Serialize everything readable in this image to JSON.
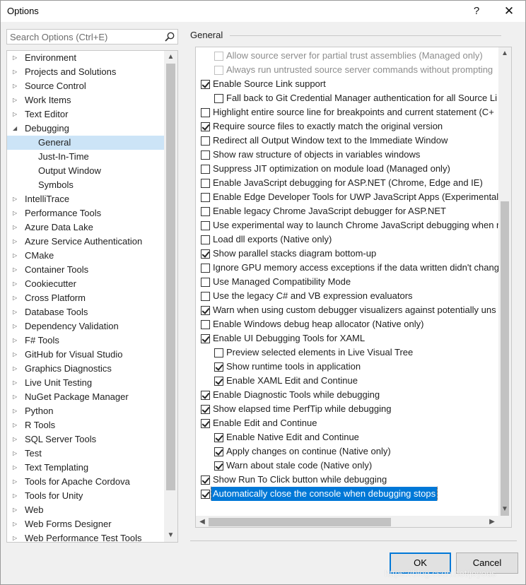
{
  "window": {
    "title": "Options",
    "help_label": "?",
    "close_label": "✕"
  },
  "search": {
    "placeholder": "Search Options (Ctrl+E)"
  },
  "tree": {
    "items": [
      {
        "label": "Environment",
        "expander": "▷",
        "level": 0
      },
      {
        "label": "Projects and Solutions",
        "expander": "▷",
        "level": 0
      },
      {
        "label": "Source Control",
        "expander": "▷",
        "level": 0
      },
      {
        "label": "Work Items",
        "expander": "▷",
        "level": 0
      },
      {
        "label": "Text Editor",
        "expander": "▷",
        "level": 0
      },
      {
        "label": "Debugging",
        "expander": "◢",
        "level": 0
      },
      {
        "label": "General",
        "expander": "",
        "level": 1,
        "selected": true
      },
      {
        "label": "Just-In-Time",
        "expander": "",
        "level": 1
      },
      {
        "label": "Output Window",
        "expander": "",
        "level": 1
      },
      {
        "label": "Symbols",
        "expander": "",
        "level": 1
      },
      {
        "label": "IntelliTrace",
        "expander": "▷",
        "level": 0
      },
      {
        "label": "Performance Tools",
        "expander": "▷",
        "level": 0
      },
      {
        "label": "Azure Data Lake",
        "expander": "▷",
        "level": 0
      },
      {
        "label": "Azure Service Authentication",
        "expander": "▷",
        "level": 0
      },
      {
        "label": "CMake",
        "expander": "▷",
        "level": 0
      },
      {
        "label": "Container Tools",
        "expander": "▷",
        "level": 0
      },
      {
        "label": "Cookiecutter",
        "expander": "▷",
        "level": 0
      },
      {
        "label": "Cross Platform",
        "expander": "▷",
        "level": 0
      },
      {
        "label": "Database Tools",
        "expander": "▷",
        "level": 0
      },
      {
        "label": "Dependency Validation",
        "expander": "▷",
        "level": 0
      },
      {
        "label": "F# Tools",
        "expander": "▷",
        "level": 0
      },
      {
        "label": "GitHub for Visual Studio",
        "expander": "▷",
        "level": 0
      },
      {
        "label": "Graphics Diagnostics",
        "expander": "▷",
        "level": 0
      },
      {
        "label": "Live Unit Testing",
        "expander": "▷",
        "level": 0
      },
      {
        "label": "NuGet Package Manager",
        "expander": "▷",
        "level": 0
      },
      {
        "label": "Python",
        "expander": "▷",
        "level": 0
      },
      {
        "label": "R Tools",
        "expander": "▷",
        "level": 0
      },
      {
        "label": "SQL Server Tools",
        "expander": "▷",
        "level": 0
      },
      {
        "label": "Test",
        "expander": "▷",
        "level": 0
      },
      {
        "label": "Text Templating",
        "expander": "▷",
        "level": 0
      },
      {
        "label": "Tools for Apache Cordova",
        "expander": "▷",
        "level": 0
      },
      {
        "label": "Tools for Unity",
        "expander": "▷",
        "level": 0
      },
      {
        "label": "Web",
        "expander": "▷",
        "level": 0
      },
      {
        "label": "Web Forms Designer",
        "expander": "▷",
        "level": 0
      },
      {
        "label": "Web Performance Test Tools",
        "expander": "▷",
        "level": 0
      }
    ],
    "scroll_up": "▲",
    "scroll_down": "▼"
  },
  "section": {
    "title": "General"
  },
  "options": [
    {
      "label": "Allow source server for partial trust assemblies (Managed only)",
      "checked": false,
      "level": 1,
      "disabled": true
    },
    {
      "label": "Always run untrusted source server commands without prompting",
      "checked": false,
      "level": 1,
      "disabled": true
    },
    {
      "label": "Enable Source Link support",
      "checked": true,
      "level": 0
    },
    {
      "label": "Fall back to Git Credential Manager authentication for all Source Li",
      "checked": false,
      "level": 1
    },
    {
      "label": "Highlight entire source line for breakpoints and current statement (C+",
      "checked": false,
      "level": 0
    },
    {
      "label": "Require source files to exactly match the original version",
      "checked": true,
      "level": 0
    },
    {
      "label": "Redirect all Output Window text to the Immediate Window",
      "checked": false,
      "level": 0
    },
    {
      "label": "Show raw structure of objects in variables windows",
      "checked": false,
      "level": 0
    },
    {
      "label": "Suppress JIT optimization on module load (Managed only)",
      "checked": false,
      "level": 0
    },
    {
      "label": "Enable JavaScript debugging for ASP.NET (Chrome, Edge and IE)",
      "checked": false,
      "level": 0
    },
    {
      "label": "Enable Edge Developer Tools for UWP JavaScript Apps (Experimental",
      "checked": false,
      "level": 0
    },
    {
      "label": "Enable legacy Chrome JavaScript debugger for ASP.NET",
      "checked": false,
      "level": 0
    },
    {
      "label": "Use experimental way to launch Chrome JavaScript debugging when r",
      "checked": false,
      "level": 0
    },
    {
      "label": "Load dll exports (Native only)",
      "checked": false,
      "level": 0
    },
    {
      "label": "Show parallel stacks diagram bottom-up",
      "checked": true,
      "level": 0
    },
    {
      "label": "Ignore GPU memory access exceptions if the data written didn't chang",
      "checked": false,
      "level": 0
    },
    {
      "label": "Use Managed Compatibility Mode",
      "checked": false,
      "level": 0
    },
    {
      "label": "Use the legacy C# and VB expression evaluators",
      "checked": false,
      "level": 0
    },
    {
      "label": "Warn when using custom debugger visualizers against potentially uns",
      "checked": true,
      "level": 0
    },
    {
      "label": "Enable Windows debug heap allocator (Native only)",
      "checked": false,
      "level": 0
    },
    {
      "label": "Enable UI Debugging Tools for XAML",
      "checked": true,
      "level": 0
    },
    {
      "label": "Preview selected elements in Live Visual Tree",
      "checked": false,
      "level": 1
    },
    {
      "label": "Show runtime tools in application",
      "checked": true,
      "level": 1
    },
    {
      "label": "Enable XAML Edit and Continue",
      "checked": true,
      "level": 1
    },
    {
      "label": "Enable Diagnostic Tools while debugging",
      "checked": true,
      "level": 0
    },
    {
      "label": "Show elapsed time PerfTip while debugging",
      "checked": true,
      "level": 0
    },
    {
      "label": "Enable Edit and Continue",
      "checked": true,
      "level": 0
    },
    {
      "label": "Enable Native Edit and Continue",
      "checked": true,
      "level": 1
    },
    {
      "label": "Apply changes on continue (Native only)",
      "checked": true,
      "level": 1
    },
    {
      "label": "Warn about stale code (Native only)",
      "checked": true,
      "level": 1
    },
    {
      "label": "Show Run To Click button while debugging",
      "checked": true,
      "level": 0
    },
    {
      "label": "Automatically close the console when debugging stops",
      "checked": true,
      "level": 0,
      "selected": true
    }
  ],
  "scroll": {
    "up": "▲",
    "down": "▼",
    "left": "◀",
    "right": "▶"
  },
  "buttons": {
    "ok": "OK",
    "cancel": "Cancel"
  },
  "watermark": "https://blog.csdn.net/joyous"
}
